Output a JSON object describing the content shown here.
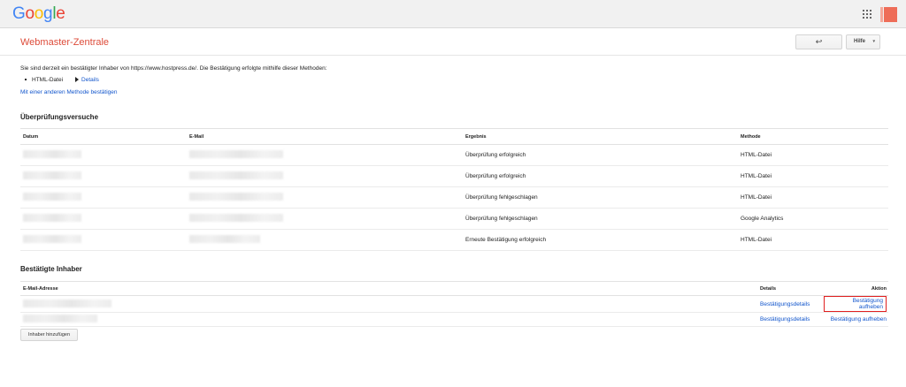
{
  "header": {
    "logo_letters": [
      {
        "ch": "G",
        "color": "#4285f4"
      },
      {
        "ch": "o",
        "color": "#ea4335"
      },
      {
        "ch": "o",
        "color": "#fbbc05"
      },
      {
        "ch": "g",
        "color": "#4285f4"
      },
      {
        "ch": "l",
        "color": "#34a853"
      },
      {
        "ch": "e",
        "color": "#ea4335"
      }
    ],
    "apps_icon": "grid-apps-icon",
    "avatar_colors": [
      "#f5a89a",
      "#ee6d58"
    ]
  },
  "titlebar": {
    "title": "Webmaster-Zentrale",
    "back_label": "↩",
    "help_label": "Hilfe",
    "help_chevron": "▾"
  },
  "intro": {
    "text": "Sie sind derzeit ein bestätigter Inhaber von https://www.hostpress.de/. Die Bestätigung erfolgte mithilfe dieser Methoden:",
    "method": "HTML-Datei",
    "details_link": "Details",
    "other_method_link": "Mit einer anderen Methode bestätigen"
  },
  "attempts": {
    "title": "Überprüfungsversuche",
    "headers": {
      "date": "Datum",
      "email": "E-Mail",
      "result": "Ergebnis",
      "method": "Methode"
    },
    "rows": [
      {
        "result": "Überprüfung erfolgreich",
        "method": "HTML-Datei"
      },
      {
        "result": "Überprüfung erfolgreich",
        "method": "HTML-Datei"
      },
      {
        "result": "Überprüfung fehlgeschlagen",
        "method": "HTML-Datei"
      },
      {
        "result": "Überprüfung fehlgeschlagen",
        "method": "Google Analytics"
      },
      {
        "result": "Erneute Bestätigung erfolgreich",
        "method": "HTML-Datei"
      }
    ]
  },
  "owners": {
    "title": "Bestätigte Inhaber",
    "headers": {
      "email": "E-Mail-Adresse",
      "details": "Details",
      "action": "Aktion"
    },
    "rows": [
      {
        "details": "Bestätigungsdetails",
        "action": "Bestätigung aufheben",
        "highlight_color": "#e02020"
      },
      {
        "details": "Bestätigungsdetails",
        "action": "Bestätigung aufheben"
      }
    ],
    "add_owner_label": "Inhaber hinzufügen"
  }
}
